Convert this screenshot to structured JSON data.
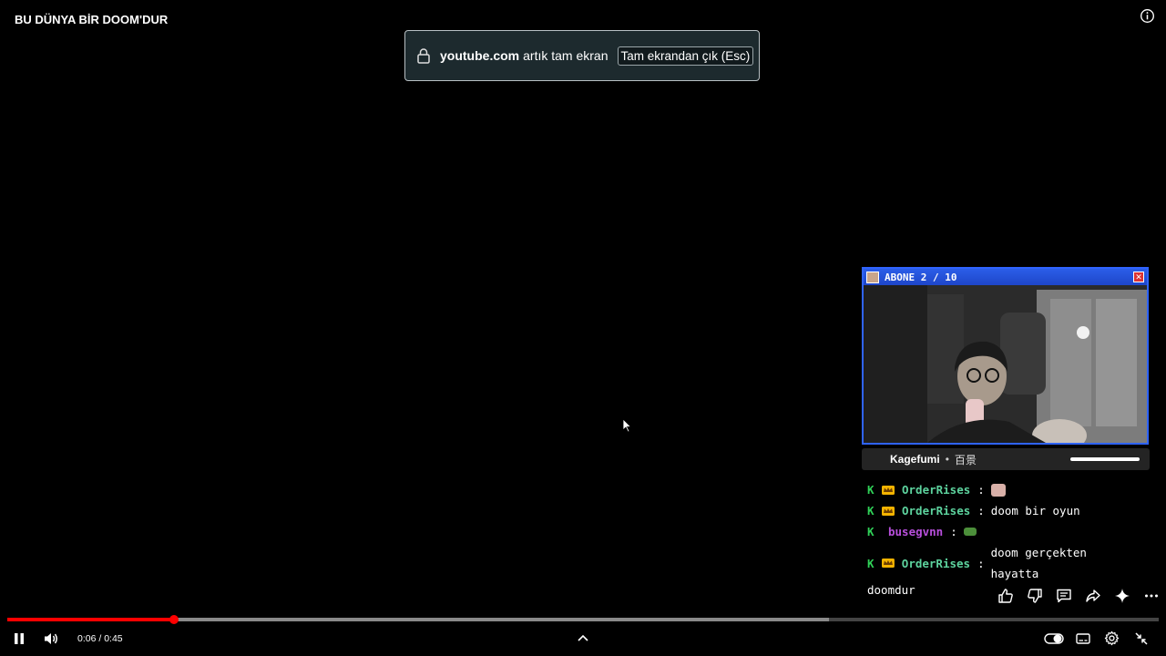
{
  "video": {
    "title": "BU DÜNYA BİR DOOM'DUR"
  },
  "fullscreen_banner": {
    "domain": "youtube.com",
    "message": "artık tam ekran",
    "exit_label": "Tam ekrandan çık (Esc)"
  },
  "overlay": {
    "cam_title": "ABONE 2 / 10",
    "now_playing": {
      "artist": "Kagefumi",
      "separator": "•",
      "song": "百景"
    }
  },
  "chat": {
    "messages": [
      {
        "user": "OrderRises",
        "user_color": "#5dd39e",
        "badges": [
          "k",
          "crown"
        ],
        "text": "",
        "emoji": "sticker"
      },
      {
        "user": "OrderRises",
        "user_color": "#5dd39e",
        "badges": [
          "k",
          "crown"
        ],
        "text": "doom bir oyun"
      },
      {
        "user": "busegvnn",
        "user_color": "#b84fdc",
        "badges": [
          "k"
        ],
        "text": "",
        "emoji": "turtle"
      },
      {
        "user": "OrderRises",
        "user_color": "#5dd39e",
        "badges": [
          "k",
          "crown"
        ],
        "text": "doom gerçekten hayatta",
        "wrap": "doomdur"
      }
    ]
  },
  "actions": [
    "like-icon",
    "dislike-icon",
    "comment-icon",
    "share-icon",
    "sparkle-icon",
    "more-icon"
  ],
  "player": {
    "current_time": "0:06",
    "duration": "0:45",
    "time_separator": "/",
    "progress_played": 0.145,
    "progress_loaded": 0.714,
    "accent_color": "#ff0000"
  }
}
